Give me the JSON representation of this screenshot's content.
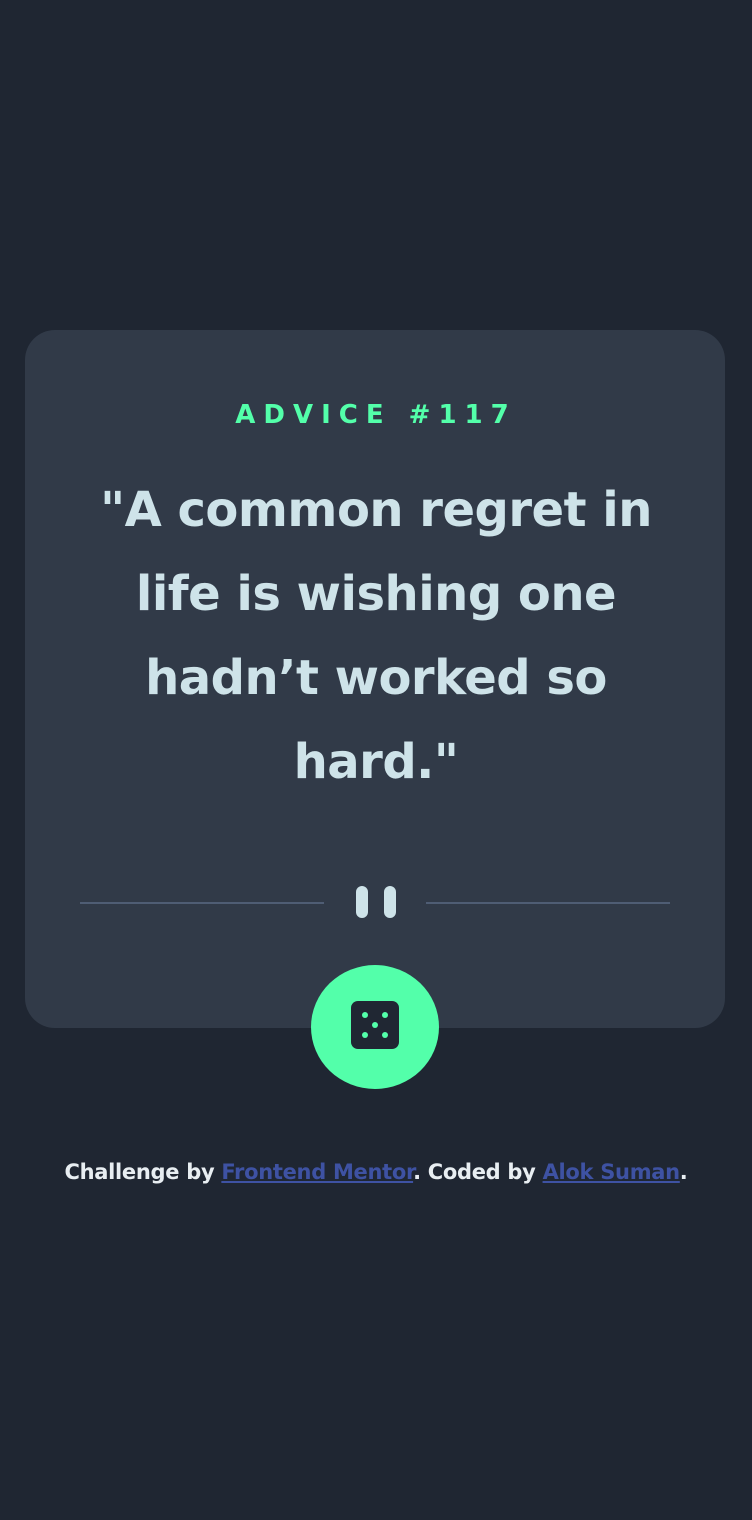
{
  "card": {
    "advice_label": "ADVICE #117",
    "quote": "\"A common regret in life is wishing one hadn’t worked so hard.\""
  },
  "button": {
    "icon": "dice-icon"
  },
  "attribution": {
    "prefix": "Challenge by ",
    "link1": "Frontend Mentor",
    "middle": ". Coded by ",
    "link2": "Alok Suman",
    "suffix": "."
  },
  "colors": {
    "background": "#1f2632",
    "card": "#313a48",
    "accent": "#53ffaa",
    "quote_text": "#cee3e9",
    "divider": "#4f5d74",
    "link": "#3e52a3"
  }
}
